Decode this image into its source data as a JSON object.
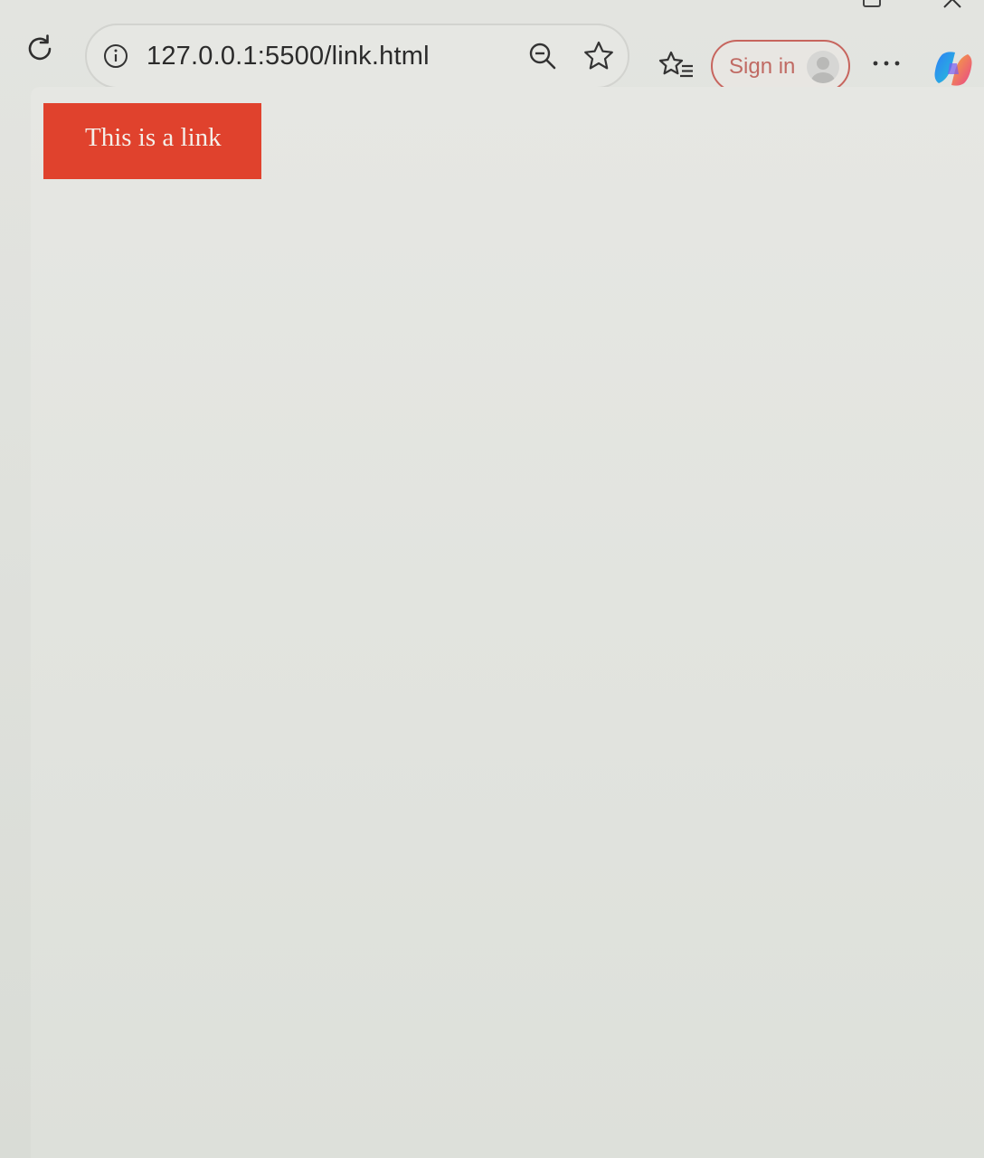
{
  "browser": {
    "address_bar": {
      "url": "127.0.0.1:5500/link.html",
      "info_icon": "info-icon",
      "zoom_icon": "zoom-out-icon",
      "favorite_icon": "star-icon"
    },
    "toolbar": {
      "reload_icon": "reload-icon",
      "favorites_icon": "favorites-list-icon",
      "signin_label": "Sign in",
      "more_icon": "more-icon",
      "copilot_icon": "copilot-icon"
    },
    "window_controls": {
      "maximize_icon": "maximize-icon",
      "close_icon": "close-icon"
    }
  },
  "page": {
    "link_label": "This is a link",
    "link_background": "#e0422d",
    "link_text_color": "#f4efe9"
  }
}
